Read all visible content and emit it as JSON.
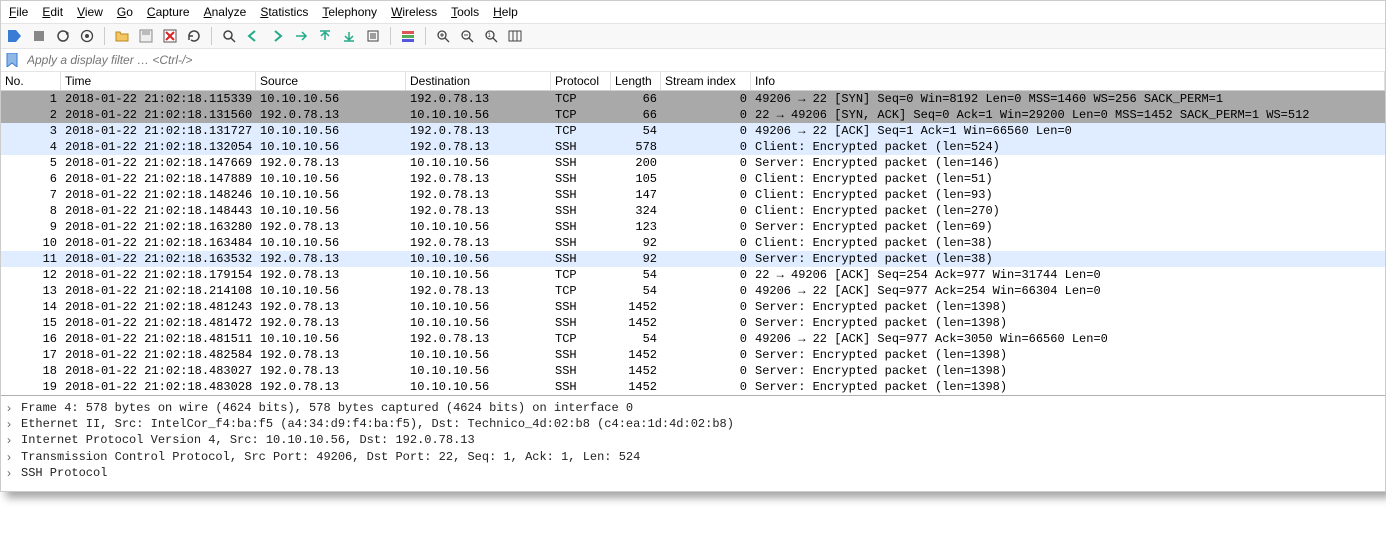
{
  "menu": [
    "File",
    "Edit",
    "View",
    "Go",
    "Capture",
    "Analyze",
    "Statistics",
    "Telephony",
    "Wireless",
    "Tools",
    "Help"
  ],
  "filter_placeholder": "Apply a display filter … <Ctrl-/>",
  "columns": [
    "No.",
    "Time",
    "Source",
    "Destination",
    "Protocol",
    "Length",
    "Stream index",
    "Info"
  ],
  "rows": [
    {
      "no": 1,
      "time": "2018-01-22 21:02:18.115339",
      "src": "10.10.10.56",
      "dst": "192.0.78.13",
      "proto": "TCP",
      "len": 66,
      "stream": 0,
      "info": "49206 → 22 [SYN] Seq=0 Win=8192 Len=0 MSS=1460 WS=256 SACK_PERM=1",
      "cls": "sel"
    },
    {
      "no": 2,
      "time": "2018-01-22 21:02:18.131560",
      "src": "192.0.78.13",
      "dst": "10.10.10.56",
      "proto": "TCP",
      "len": 66,
      "stream": 0,
      "info": "22 → 49206 [SYN, ACK] Seq=0 Ack=1 Win=29200 Len=0 MSS=1452 SACK_PERM=1 WS=512",
      "cls": "sel"
    },
    {
      "no": 3,
      "time": "2018-01-22 21:02:18.131727",
      "src": "10.10.10.56",
      "dst": "192.0.78.13",
      "proto": "TCP",
      "len": 54,
      "stream": 0,
      "info": "49206 → 22 [ACK] Seq=1 Ack=1 Win=66560 Len=0",
      "cls": "tcp"
    },
    {
      "no": 4,
      "time": "2018-01-22 21:02:18.132054",
      "src": "10.10.10.56",
      "dst": "192.0.78.13",
      "proto": "SSH",
      "len": 578,
      "stream": 0,
      "info": "Client: Encrypted packet (len=524)",
      "cls": "tcp"
    },
    {
      "no": 5,
      "time": "2018-01-22 21:02:18.147669",
      "src": "192.0.78.13",
      "dst": "10.10.10.56",
      "proto": "SSH",
      "len": 200,
      "stream": 0,
      "info": "Server: Encrypted packet (len=146)",
      "cls": "white"
    },
    {
      "no": 6,
      "time": "2018-01-22 21:02:18.147889",
      "src": "10.10.10.56",
      "dst": "192.0.78.13",
      "proto": "SSH",
      "len": 105,
      "stream": 0,
      "info": "Client: Encrypted packet (len=51)",
      "cls": "white"
    },
    {
      "no": 7,
      "time": "2018-01-22 21:02:18.148246",
      "src": "10.10.10.56",
      "dst": "192.0.78.13",
      "proto": "SSH",
      "len": 147,
      "stream": 0,
      "info": "Client: Encrypted packet (len=93)",
      "cls": "white"
    },
    {
      "no": 8,
      "time": "2018-01-22 21:02:18.148443",
      "src": "10.10.10.56",
      "dst": "192.0.78.13",
      "proto": "SSH",
      "len": 324,
      "stream": 0,
      "info": "Client: Encrypted packet (len=270)",
      "cls": "white"
    },
    {
      "no": 9,
      "time": "2018-01-22 21:02:18.163280",
      "src": "192.0.78.13",
      "dst": "10.10.10.56",
      "proto": "SSH",
      "len": 123,
      "stream": 0,
      "info": "Server: Encrypted packet (len=69)",
      "cls": "white"
    },
    {
      "no": 10,
      "time": "2018-01-22 21:02:18.163484",
      "src": "10.10.10.56",
      "dst": "192.0.78.13",
      "proto": "SSH",
      "len": 92,
      "stream": 0,
      "info": "Client: Encrypted packet (len=38)",
      "cls": "white"
    },
    {
      "no": 11,
      "time": "2018-01-22 21:02:18.163532",
      "src": "192.0.78.13",
      "dst": "10.10.10.56",
      "proto": "SSH",
      "len": 92,
      "stream": 0,
      "info": "Server: Encrypted packet (len=38)",
      "cls": "tcp"
    },
    {
      "no": 12,
      "time": "2018-01-22 21:02:18.179154",
      "src": "192.0.78.13",
      "dst": "10.10.10.56",
      "proto": "TCP",
      "len": 54,
      "stream": 0,
      "info": "22 → 49206 [ACK] Seq=254 Ack=977 Win=31744 Len=0",
      "cls": "white"
    },
    {
      "no": 13,
      "time": "2018-01-22 21:02:18.214108",
      "src": "10.10.10.56",
      "dst": "192.0.78.13",
      "proto": "TCP",
      "len": 54,
      "stream": 0,
      "info": "49206 → 22 [ACK] Seq=977 Ack=254 Win=66304 Len=0",
      "cls": "white"
    },
    {
      "no": 14,
      "time": "2018-01-22 21:02:18.481243",
      "src": "192.0.78.13",
      "dst": "10.10.10.56",
      "proto": "SSH",
      "len": 1452,
      "stream": 0,
      "info": "Server: Encrypted packet (len=1398)",
      "cls": "white"
    },
    {
      "no": 15,
      "time": "2018-01-22 21:02:18.481472",
      "src": "192.0.78.13",
      "dst": "10.10.10.56",
      "proto": "SSH",
      "len": 1452,
      "stream": 0,
      "info": "Server: Encrypted packet (len=1398)",
      "cls": "white"
    },
    {
      "no": 16,
      "time": "2018-01-22 21:02:18.481511",
      "src": "10.10.10.56",
      "dst": "192.0.78.13",
      "proto": "TCP",
      "len": 54,
      "stream": 0,
      "info": "49206 → 22 [ACK] Seq=977 Ack=3050 Win=66560 Len=0",
      "cls": "white"
    },
    {
      "no": 17,
      "time": "2018-01-22 21:02:18.482584",
      "src": "192.0.78.13",
      "dst": "10.10.10.56",
      "proto": "SSH",
      "len": 1452,
      "stream": 0,
      "info": "Server: Encrypted packet (len=1398)",
      "cls": "white"
    },
    {
      "no": 18,
      "time": "2018-01-22 21:02:18.483027",
      "src": "192.0.78.13",
      "dst": "10.10.10.56",
      "proto": "SSH",
      "len": 1452,
      "stream": 0,
      "info": "Server: Encrypted packet (len=1398)",
      "cls": "white"
    },
    {
      "no": 19,
      "time": "2018-01-22 21:02:18.483028",
      "src": "192.0.78.13",
      "dst": "10.10.10.56",
      "proto": "SSH",
      "len": 1452,
      "stream": 0,
      "info": "Server: Encrypted packet (len=1398)",
      "cls": "white"
    }
  ],
  "details": [
    "Frame 4: 578 bytes on wire (4624 bits), 578 bytes captured (4624 bits) on interface 0",
    "Ethernet II, Src: IntelCor_f4:ba:f5 (a4:34:d9:f4:ba:f5), Dst: Technico_4d:02:b8 (c4:ea:1d:4d:02:b8)",
    "Internet Protocol Version 4, Src: 10.10.10.56, Dst: 192.0.78.13",
    "Transmission Control Protocol, Src Port: 49206, Dst Port: 22, Seq: 1, Ack: 1, Len: 524",
    "SSH Protocol"
  ]
}
